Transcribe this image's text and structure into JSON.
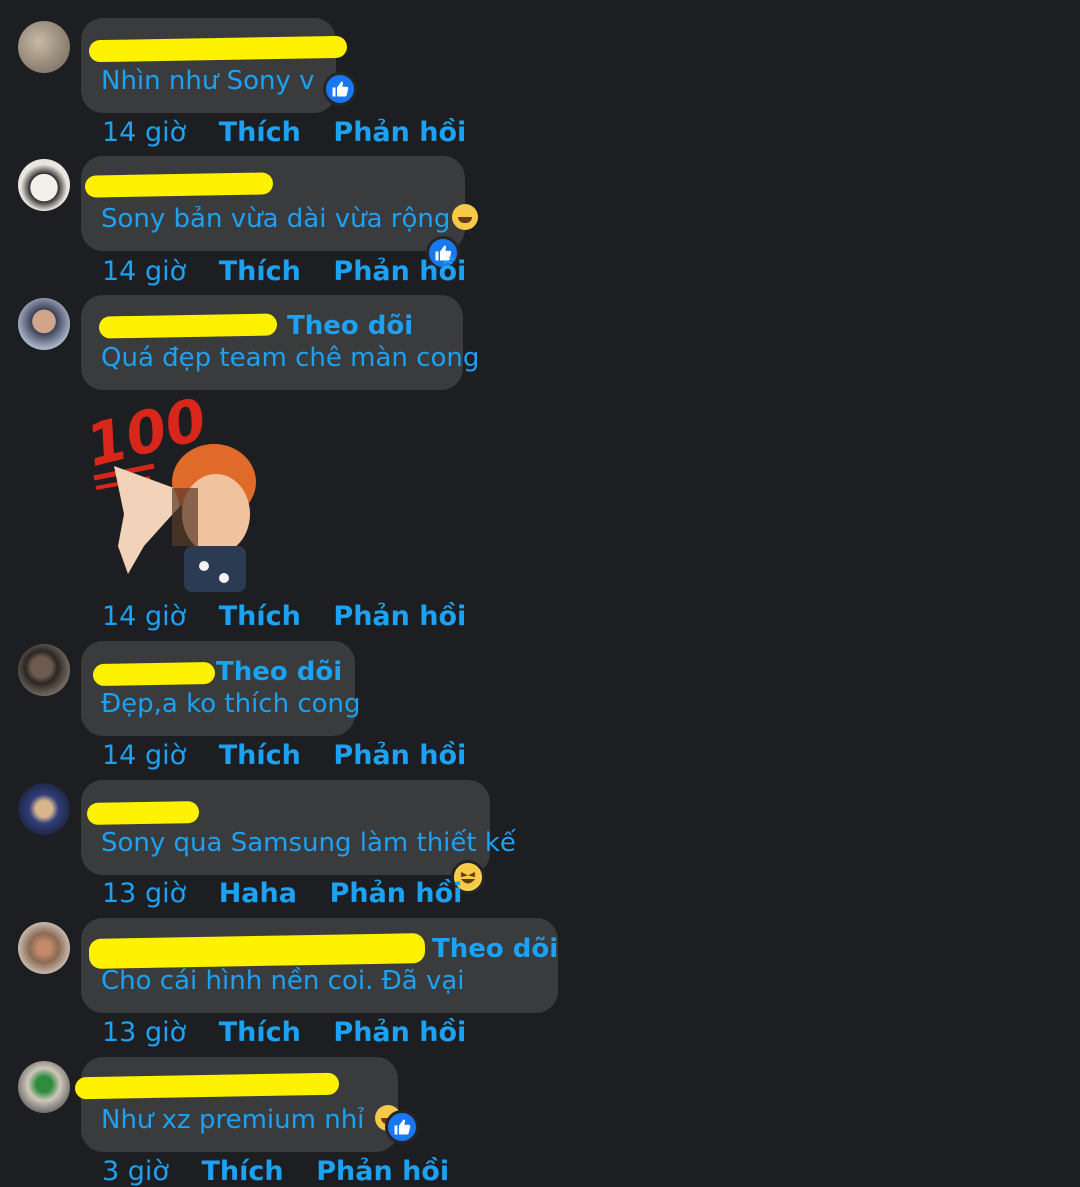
{
  "comments": [
    {
      "text": "Nhìn như Sony v",
      "time": "14 giờ",
      "action": "Thích",
      "reply": "Phản hồi",
      "follow": "",
      "reaction": "like"
    },
    {
      "text": "Sony bản vừa dài vừa rộng",
      "time": "14 giờ",
      "action": "Thích",
      "reply": "Phản hồi",
      "follow": "",
      "reaction": "like"
    },
    {
      "text": "Quá đẹp team chê màn cong",
      "time": "14 giờ",
      "action": "Thích",
      "reply": "Phản hồi",
      "follow": "Theo dõi",
      "reaction": ""
    },
    {
      "text": "",
      "time": "14 giờ",
      "action": "Thích",
      "reply": "Phản hồi",
      "follow": "",
      "reaction": "",
      "sticker": "100-sticker"
    },
    {
      "text": "Đẹp,a ko thích cong",
      "time": "14 giờ",
      "action": "Thích",
      "reply": "Phản hồi",
      "follow": "Theo dõi",
      "reaction": ""
    },
    {
      "text": "Sony qua Samsung làm thiết kế",
      "time": "13 giờ",
      "action": "Haha",
      "reply": "Phản hồi",
      "follow": "",
      "reaction": "haha"
    },
    {
      "text": "Cho cái hình nền coi. Đã vại",
      "time": "13 giờ",
      "action": "Thích",
      "reply": "Phản hồi",
      "follow": "Theo dõi",
      "reaction": ""
    },
    {
      "text": "Như xz premium nhỉ",
      "time": "3 giờ",
      "action": "Thích",
      "reply": "Phản hồi",
      "follow": "",
      "reaction": "like"
    }
  ],
  "colors": {
    "accent": "#1da1f2",
    "bubble": "#3a3b3c",
    "background": "#1c1e21",
    "redaction": "#fff200"
  },
  "icons": {
    "like": "thumbs-up-icon",
    "haha": "laughing-face-icon"
  }
}
